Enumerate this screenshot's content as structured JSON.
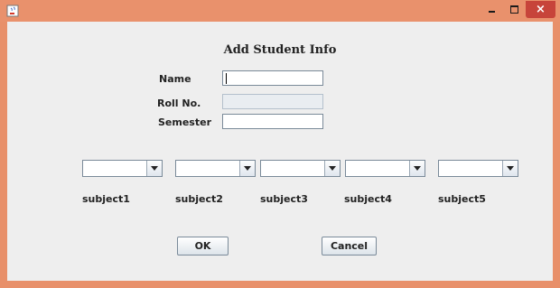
{
  "window": {
    "close_symbol": "×",
    "icon": "java-cup-icon"
  },
  "form": {
    "title": "Add Student Info",
    "name_label": "Name",
    "name_value": "",
    "roll_label": "Roll No.",
    "roll_value": "",
    "semester_label": "Semester",
    "semester_value": ""
  },
  "subjects": [
    {
      "label": "subject1",
      "selected": ""
    },
    {
      "label": "subject2",
      "selected": ""
    },
    {
      "label": "subject3",
      "selected": ""
    },
    {
      "label": "subject4",
      "selected": ""
    },
    {
      "label": "subject5",
      "selected": ""
    }
  ],
  "buttons": {
    "ok": "OK",
    "cancel": "Cancel"
  },
  "colors": {
    "titlebar": "#e9916c",
    "close": "#c7443a",
    "panel": "#eeeeee"
  }
}
